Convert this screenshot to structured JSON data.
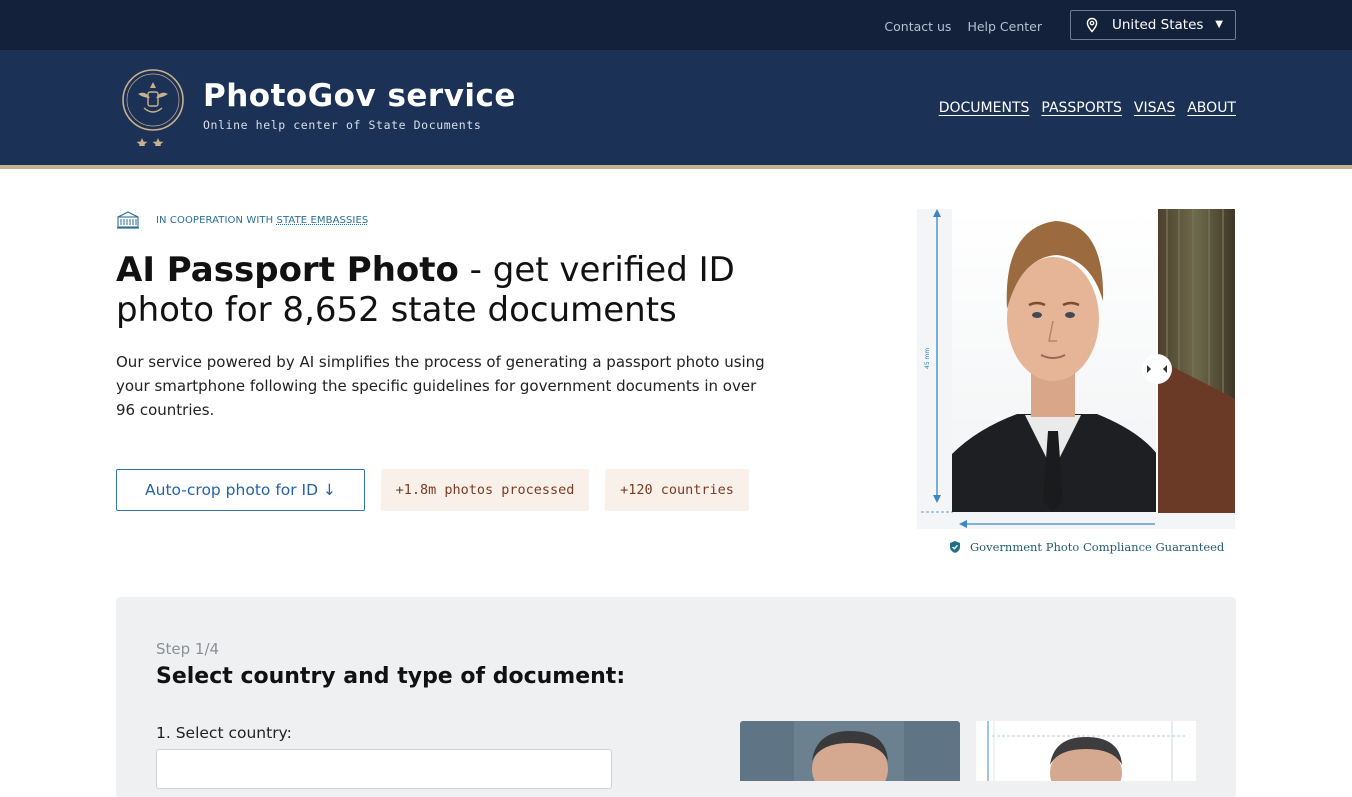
{
  "topbar": {
    "contact": "Contact us",
    "help": "Help Center",
    "country": "United States"
  },
  "brand": {
    "title": "PhotoGov service",
    "subtitle": "Online help center of State Documents"
  },
  "nav": [
    "DOCUMENTS",
    "PASSPORTS",
    "VISAS",
    "ABOUT"
  ],
  "hero": {
    "coop_prefix": "IN COOPERATION WITH ",
    "coop_link": "STATE EMBASSIES",
    "title_bold": "AI Passport Photo",
    "title_rest": " - get verified ID photo for 8,652 state documents",
    "description": "Our service powered by AI simplifies the process of generating a passport photo using your smartphone following the specific guidelines for government documents in over 96 countries.",
    "cta": "Auto-crop photo for ID ↓",
    "badge_photos": "+1.8m photos processed",
    "badge_countries": "+120 countries",
    "photo_dim": "45 mm",
    "compliance": "Government Photo Compliance Guaranteed"
  },
  "step": {
    "label": "Step 1/4",
    "title": "Select country and type of document:",
    "select_country": "1. Select country:"
  },
  "colors": {
    "topbar": "#13213a",
    "header": "#1b3256",
    "accent_line": "#c9b08c",
    "link_blue": "#2563a8"
  }
}
